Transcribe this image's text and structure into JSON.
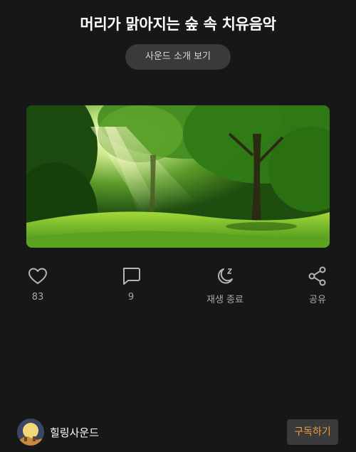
{
  "header": {
    "title": "머리가 맑아지는 숲 속 치유음악",
    "intro_button_label": "사운드 소개 보기"
  },
  "hero": {
    "image": "sunlit-forest-with-green-grass"
  },
  "actions": [
    {
      "icon": "heart-icon",
      "label": "83"
    },
    {
      "icon": "comment-icon",
      "label": "9"
    },
    {
      "icon": "moon-sleep-icon",
      "label": "재생 종료"
    },
    {
      "icon": "share-icon",
      "label": "공유"
    }
  ],
  "channel": {
    "name": "힐링사운드",
    "subscribe_label": "구독하기"
  },
  "colors": {
    "background": "#171717",
    "button_bg": "#3a3a3a",
    "subscribe_text": "#f29a3a",
    "muted_text": "#a9a9a9"
  }
}
